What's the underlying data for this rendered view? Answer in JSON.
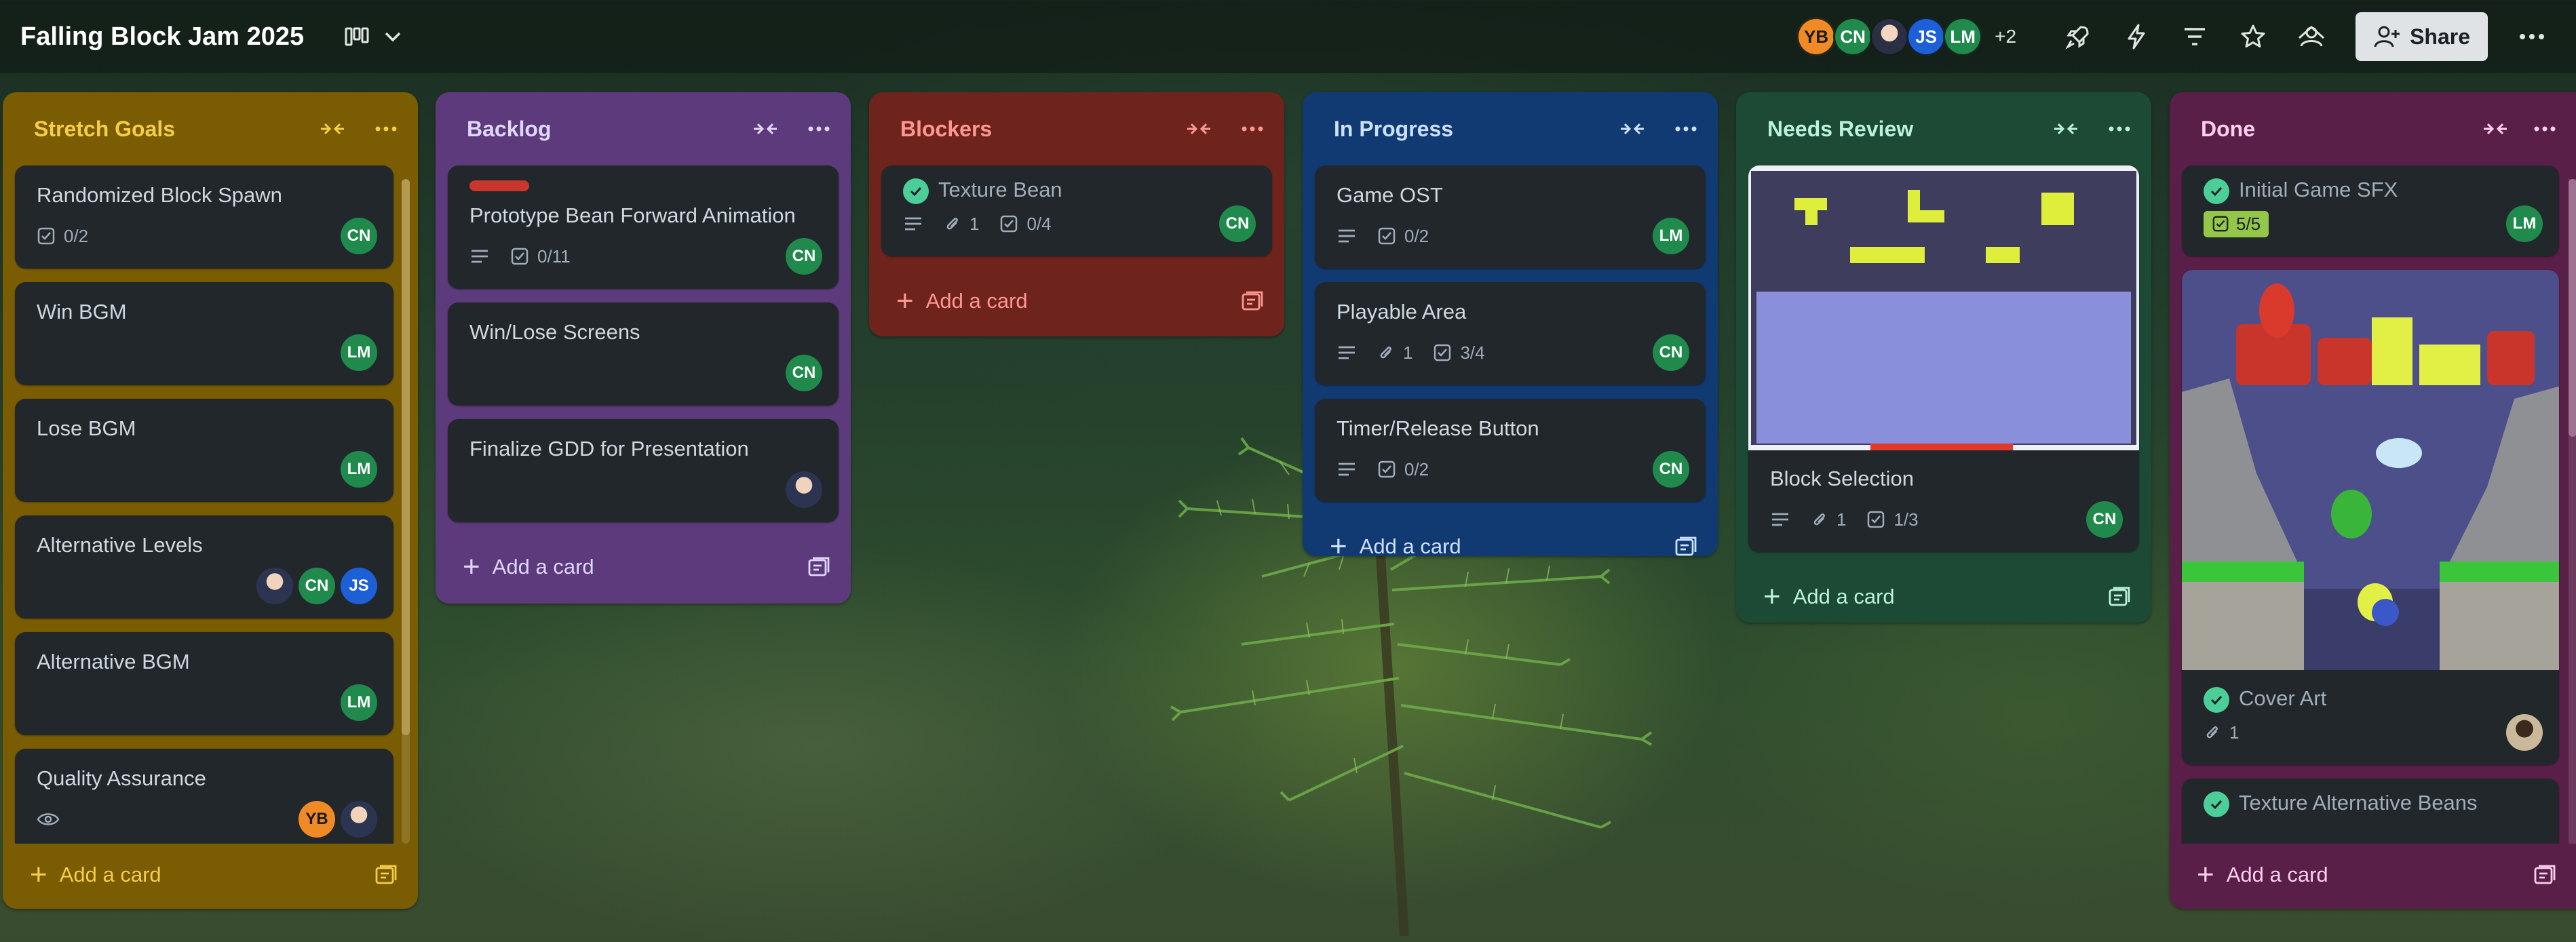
{
  "board": {
    "title": "Falling Block Jam 2025"
  },
  "header": {
    "members": [
      "YB",
      "CN",
      "",
      "JS",
      "LM"
    ],
    "more_count": "+2",
    "share_label": "Share"
  },
  "add_card_label": "Add a card",
  "lists": [
    {
      "title": "Stretch Goals",
      "color": "#7f5f01",
      "cards": [
        {
          "title": "Randomized Block Spawn",
          "checklist": "0/2",
          "members": [
            "CN"
          ]
        },
        {
          "title": "Win BGM",
          "members": [
            "LM"
          ]
        },
        {
          "title": "Lose BGM",
          "members": [
            "LM"
          ]
        },
        {
          "title": "Alternative Levels",
          "members": [
            "",
            "CN",
            "JS"
          ]
        },
        {
          "title": "Alternative BGM",
          "members": [
            "LM"
          ]
        },
        {
          "title": "Quality Assurance",
          "members": [
            "YB",
            ""
          ]
        }
      ]
    },
    {
      "title": "Backlog",
      "color": "#5e3a7c",
      "cards": [
        {
          "title": "Prototype Bean Forward Animation",
          "checklist": "0/11",
          "members": [
            "CN"
          ]
        },
        {
          "title": "Win/Lose Screens",
          "members": [
            "CN"
          ]
        },
        {
          "title": "Finalize GDD for Presentation",
          "members": [
            ""
          ]
        }
      ]
    },
    {
      "title": "Blockers",
      "color": "#73241f",
      "cards": [
        {
          "title": "Texture Bean",
          "attachments": "1",
          "checklist": "0/4",
          "members": [
            "CN"
          ]
        }
      ]
    },
    {
      "title": "In Progress",
      "color": "#123a72",
      "cards": [
        {
          "title": "Game OST",
          "checklist": "0/2",
          "members": [
            "LM"
          ]
        },
        {
          "title": "Playable Area",
          "attachments": "1",
          "checklist": "3/4",
          "members": [
            "CN"
          ]
        },
        {
          "title": "Timer/Release Button",
          "checklist": "0/2",
          "members": [
            "CN"
          ]
        }
      ]
    },
    {
      "title": "Needs Review",
      "color": "#1c4a34",
      "cards": [
        {
          "title": "Block Selection",
          "attachments": "1",
          "checklist": "1/3",
          "members": [
            "CN"
          ]
        }
      ]
    },
    {
      "title": "Done",
      "color": "#5b1f4a",
      "cards": [
        {
          "title": "Initial Game SFX",
          "checklist": "5/5",
          "members": [
            "LM"
          ]
        },
        {
          "title": "Cover Art",
          "attachments": "1",
          "members": [
            ""
          ]
        },
        {
          "title": "Texture Alternative Beans"
        }
      ]
    }
  ]
}
